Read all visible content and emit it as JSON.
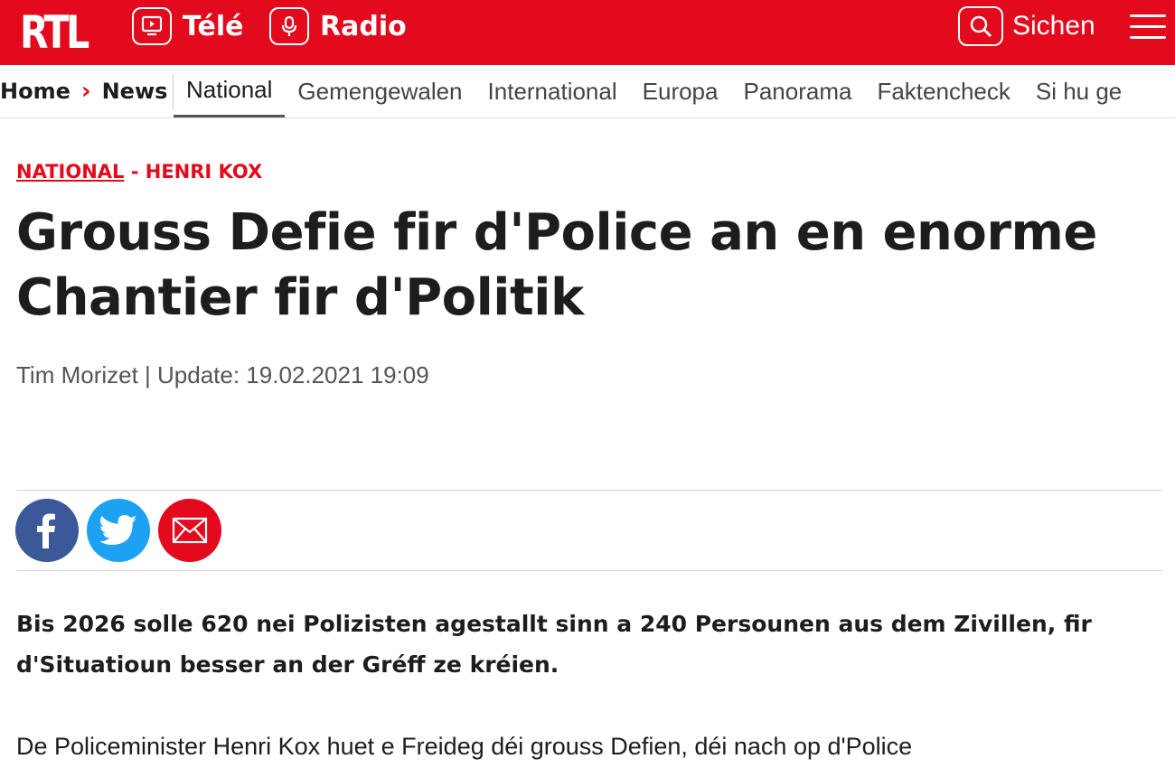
{
  "header": {
    "logo": "RTL",
    "tele_label": "Télé",
    "radio_label": "Radio",
    "search_label": "Sichen",
    "brand_color": "#e20a1c"
  },
  "breadcrumb": {
    "home": "Home",
    "separator": "›",
    "news": "News"
  },
  "tabs": [
    {
      "label": "National",
      "active": true
    },
    {
      "label": "Gemengewalen"
    },
    {
      "label": "International"
    },
    {
      "label": "Europa"
    },
    {
      "label": "Panorama"
    },
    {
      "label": "Faktencheck"
    },
    {
      "label": "Si hu ge"
    }
  ],
  "article": {
    "section": "NATIONAL",
    "kicker_sep": " - ",
    "topic": "HENRI KOX",
    "headline": "Grouss Defie fir d'Police an en enorme Chantier fir d'Politik",
    "byline": "Tim Morizet | Update: 19.02.2021 19:09",
    "lead": "Bis 2026 solle 620 nei Polizisten agestallt sinn a 240 Persounen aus dem Zivillen, fir d'Situatioun besser an der Gréff ze kréien.",
    "body": "De Policeminister Henri Kox huet e Freideg déi grouss Defien, déi nach op d'Police"
  },
  "share": {
    "facebook_icon": "facebook-icon",
    "twitter_icon": "twitter-icon",
    "mail_icon": "mail-icon",
    "facebook_color": "#3b5998",
    "twitter_color": "#1da1f2",
    "mail_color": "#e20a1c"
  }
}
